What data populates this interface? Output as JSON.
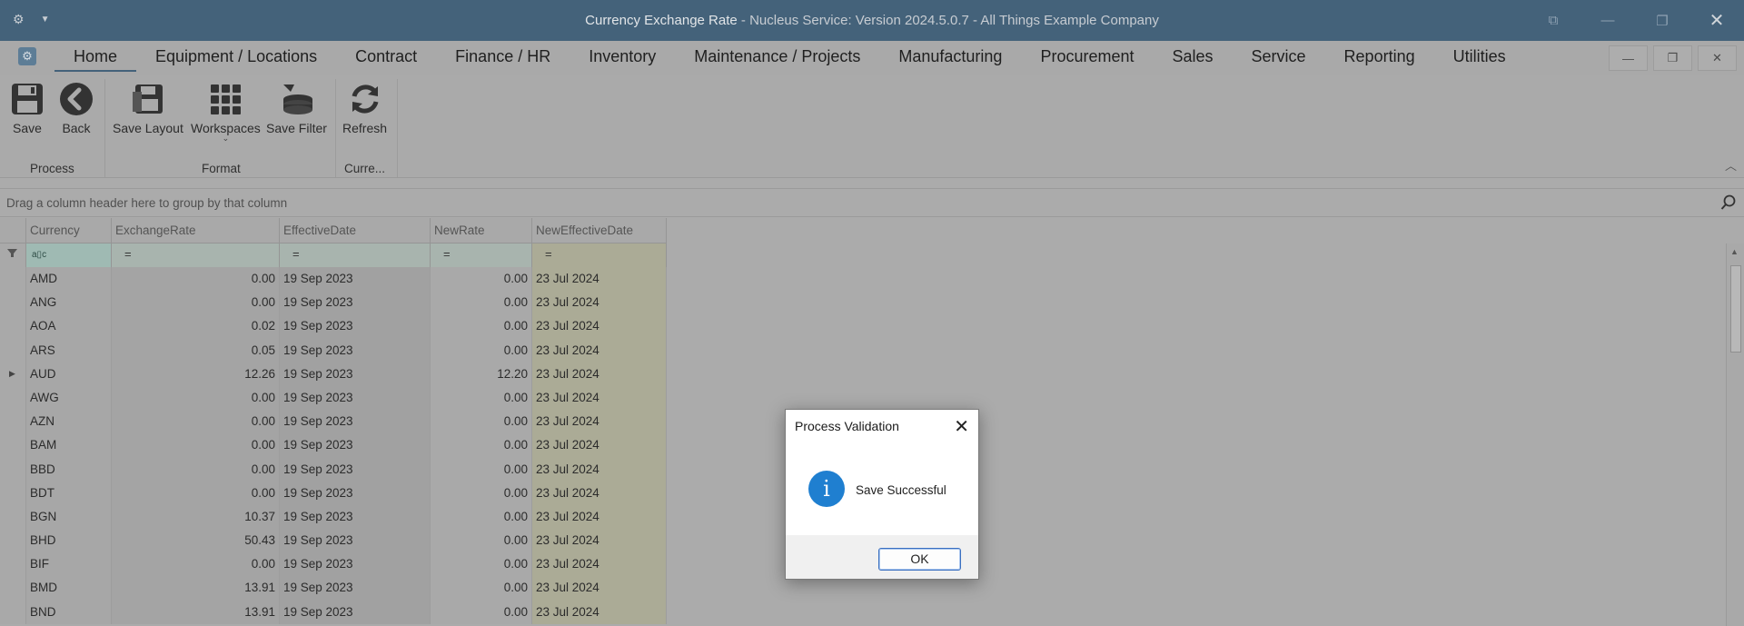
{
  "titlebar": {
    "app_title": "Currency Exchange Rate",
    "subtitle": " - Nucleus Service: Version 2024.5.0.7 - All Things Example Company"
  },
  "menu": {
    "tabs": [
      "Home",
      "Equipment / Locations",
      "Contract",
      "Finance / HR",
      "Inventory",
      "Maintenance / Projects",
      "Manufacturing",
      "Procurement",
      "Sales",
      "Service",
      "Reporting",
      "Utilities"
    ],
    "active": "Home"
  },
  "ribbon": {
    "save": "Save",
    "back": "Back",
    "save_layout": "Save Layout",
    "workspaces": "Workspaces",
    "save_filter": "Save Filter",
    "refresh": "Refresh",
    "group_process": "Process",
    "group_format": "Format",
    "group_current": "Curre..."
  },
  "group_panel": {
    "hint": "Drag a column header here to group by that column"
  },
  "grid": {
    "columns": [
      "Currency",
      "ExchangeRate",
      "EffectiveDate",
      "NewRate",
      "NewEffectiveDate"
    ],
    "filter_text_icon": "a▯c",
    "filter_equals": "=",
    "rows": [
      {
        "currency": "AMD",
        "exchange_rate": "0.00",
        "effective_date": "19 Sep 2023",
        "new_rate": "0.00",
        "new_effective_date": "23 Jul 2024",
        "focused": false
      },
      {
        "currency": "ANG",
        "exchange_rate": "0.00",
        "effective_date": "19 Sep 2023",
        "new_rate": "0.00",
        "new_effective_date": "23 Jul 2024",
        "focused": false
      },
      {
        "currency": "AOA",
        "exchange_rate": "0.02",
        "effective_date": "19 Sep 2023",
        "new_rate": "0.00",
        "new_effective_date": "23 Jul 2024",
        "focused": false
      },
      {
        "currency": "ARS",
        "exchange_rate": "0.05",
        "effective_date": "19 Sep 2023",
        "new_rate": "0.00",
        "new_effective_date": "23 Jul 2024",
        "focused": false
      },
      {
        "currency": "AUD",
        "exchange_rate": "12.26",
        "effective_date": "19 Sep 2023",
        "new_rate": "12.20",
        "new_effective_date": "23 Jul 2024",
        "focused": true
      },
      {
        "currency": "AWG",
        "exchange_rate": "0.00",
        "effective_date": "19 Sep 2023",
        "new_rate": "0.00",
        "new_effective_date": "23 Jul 2024",
        "focused": false
      },
      {
        "currency": "AZN",
        "exchange_rate": "0.00",
        "effective_date": "19 Sep 2023",
        "new_rate": "0.00",
        "new_effective_date": "23 Jul 2024",
        "focused": false
      },
      {
        "currency": "BAM",
        "exchange_rate": "0.00",
        "effective_date": "19 Sep 2023",
        "new_rate": "0.00",
        "new_effective_date": "23 Jul 2024",
        "focused": false
      },
      {
        "currency": "BBD",
        "exchange_rate": "0.00",
        "effective_date": "19 Sep 2023",
        "new_rate": "0.00",
        "new_effective_date": "23 Jul 2024",
        "focused": false
      },
      {
        "currency": "BDT",
        "exchange_rate": "0.00",
        "effective_date": "19 Sep 2023",
        "new_rate": "0.00",
        "new_effective_date": "23 Jul 2024",
        "focused": false
      },
      {
        "currency": "BGN",
        "exchange_rate": "10.37",
        "effective_date": "19 Sep 2023",
        "new_rate": "0.00",
        "new_effective_date": "23 Jul 2024",
        "focused": false
      },
      {
        "currency": "BHD",
        "exchange_rate": "50.43",
        "effective_date": "19 Sep 2023",
        "new_rate": "0.00",
        "new_effective_date": "23 Jul 2024",
        "focused": false
      },
      {
        "currency": "BIF",
        "exchange_rate": "0.00",
        "effective_date": "19 Sep 2023",
        "new_rate": "0.00",
        "new_effective_date": "23 Jul 2024",
        "focused": false
      },
      {
        "currency": "BMD",
        "exchange_rate": "13.91",
        "effective_date": "19 Sep 2023",
        "new_rate": "0.00",
        "new_effective_date": "23 Jul 2024",
        "focused": false
      },
      {
        "currency": "BND",
        "exchange_rate": "13.91",
        "effective_date": "19 Sep 2023",
        "new_rate": "0.00",
        "new_effective_date": "23 Jul 2024",
        "focused": false
      }
    ]
  },
  "dialog": {
    "title": "Process Validation",
    "message": "Save Successful",
    "ok_label": "OK",
    "icon": "info-icon",
    "icon_glyph": "i"
  },
  "colors": {
    "titlebar": "#44627a",
    "info_blue": "#1f7fd0"
  }
}
